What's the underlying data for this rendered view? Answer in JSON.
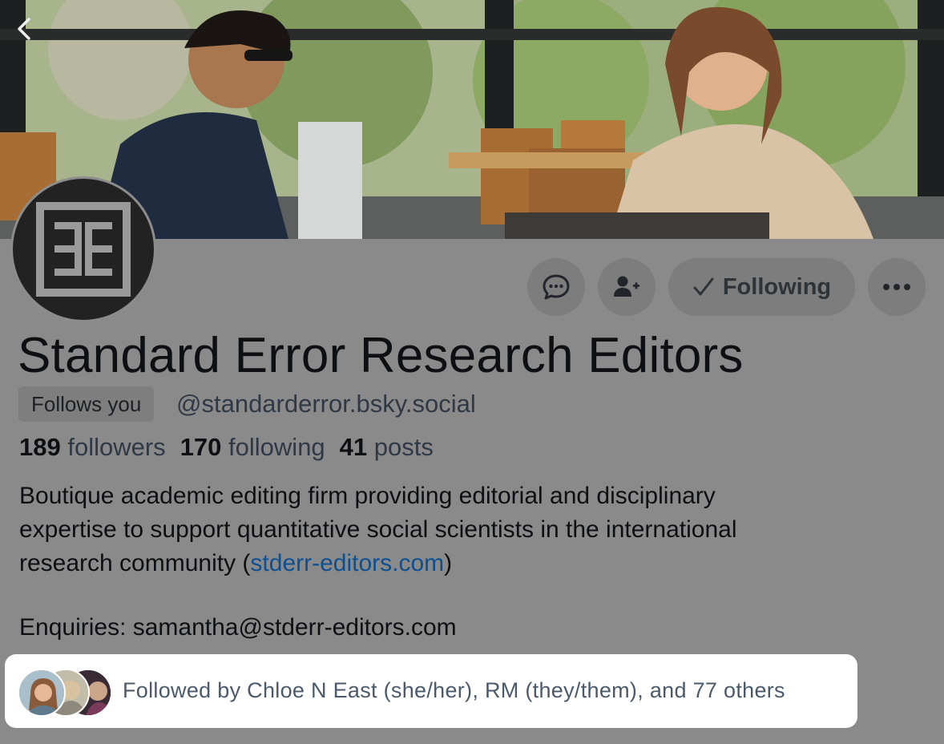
{
  "profile": {
    "display_name": "Standard Error Research Editors",
    "handle": "@standarderror.bsky.social",
    "follows_you_badge": "Follows you"
  },
  "actions": {
    "message_icon": "chat-bubble-icon",
    "follow_icon": "add-person-icon",
    "following_label": "Following",
    "more_icon": "ellipsis-icon"
  },
  "stats": [
    {
      "count": "189",
      "label": "followers"
    },
    {
      "count": "170",
      "label": "following"
    },
    {
      "count": "41",
      "label": "posts"
    }
  ],
  "bio": {
    "line1": "Boutique academic editing firm providing editorial and disciplinary",
    "line2": "expertise to support quantitative social scientists in the international",
    "line3_prefix": "research community (",
    "link_text": "stderr-editors.com",
    "line3_suffix": ")",
    "enquiries": "Enquiries: samantha@stderr-editors.com"
  },
  "followed_by": {
    "text": "Followed by Chloe N East (she/her), RM (they/them), and 77 others"
  },
  "colors": {
    "overlay_gray": "#8a8a8a",
    "link_blue": "#0b4f94",
    "text_dark": "#0d0f12",
    "text_muted": "#2f3945"
  }
}
